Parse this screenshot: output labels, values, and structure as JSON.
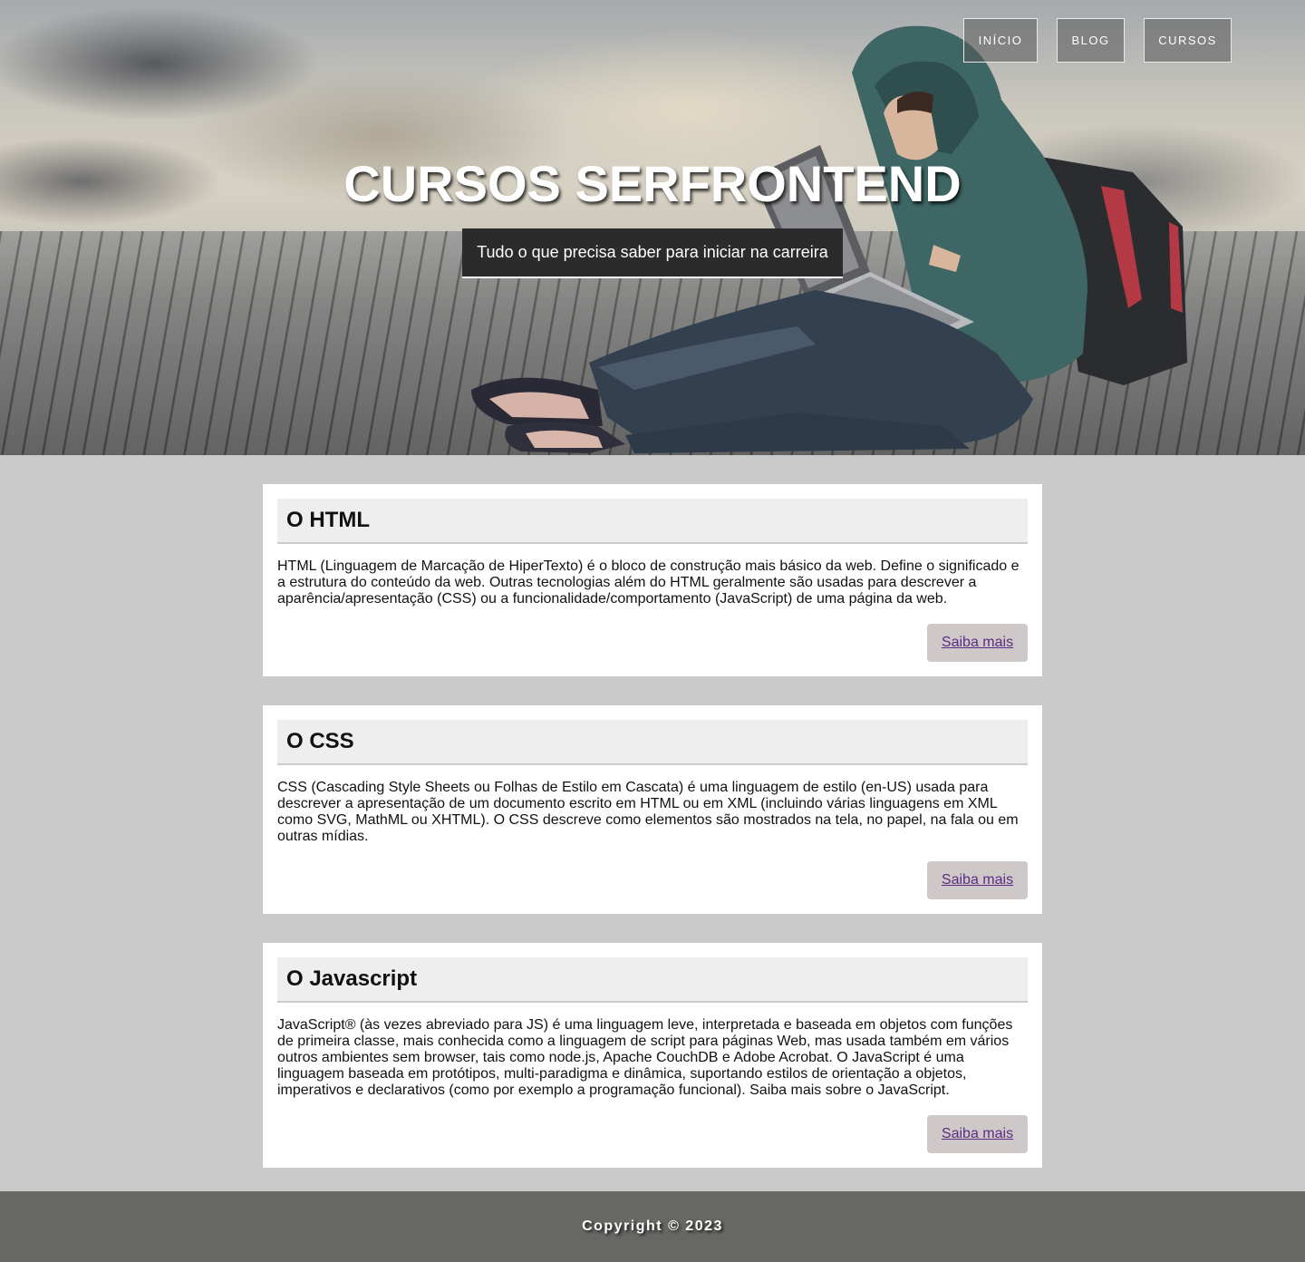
{
  "nav": {
    "items": [
      {
        "label": "INÍCIO"
      },
      {
        "label": "BLOG"
      },
      {
        "label": "CURSOS"
      }
    ]
  },
  "hero": {
    "title": "CURSOS SERFRONTEND",
    "subtitle": "Tudo o que precisa saber para iniciar na carreira"
  },
  "cards": [
    {
      "title": "O HTML",
      "text": "HTML (Linguagem de Marcação de HiperTexto) é o bloco de construção mais básico da web. Define o significado e a estrutura do conteúdo da web. Outras tecnologias além do HTML geralmente são usadas para descrever a aparência/apresentação (CSS) ou a funcionalidade/comportamento (JavaScript) de uma página da web.",
      "button": "Saiba mais"
    },
    {
      "title": "O CSS",
      "text": "CSS (Cascading Style Sheets ou Folhas de Estilo em Cascata) é uma linguagem de estilo (en-US) usada para descrever a apresentação de um documento escrito em HTML ou em XML (incluindo várias linguagens em XML como SVG, MathML ou XHTML). O CSS descreve como elementos são mostrados na tela, no papel, na fala ou em outras mídias.",
      "button": "Saiba mais"
    },
    {
      "title": "O Javascript",
      "text": "JavaScript® (às vezes abreviado para JS) é uma linguagem leve, interpretada e baseada em objetos com funções de primeira classe, mais conhecida como a linguagem de script para páginas Web, mas usada também em vários outros ambientes sem browser, tais como node.js, Apache CouchDB e Adobe Acrobat. O JavaScript é uma linguagem baseada em protótipos, multi-paradigma e dinâmica, suportando estilos de orientação a objetos, imperativos e declarativos (como por exemplo a programação funcional). Saiba mais sobre o JavaScript.",
      "button": "Saiba mais"
    }
  ],
  "footer": {
    "copyright": "Copyright © 2023"
  }
}
